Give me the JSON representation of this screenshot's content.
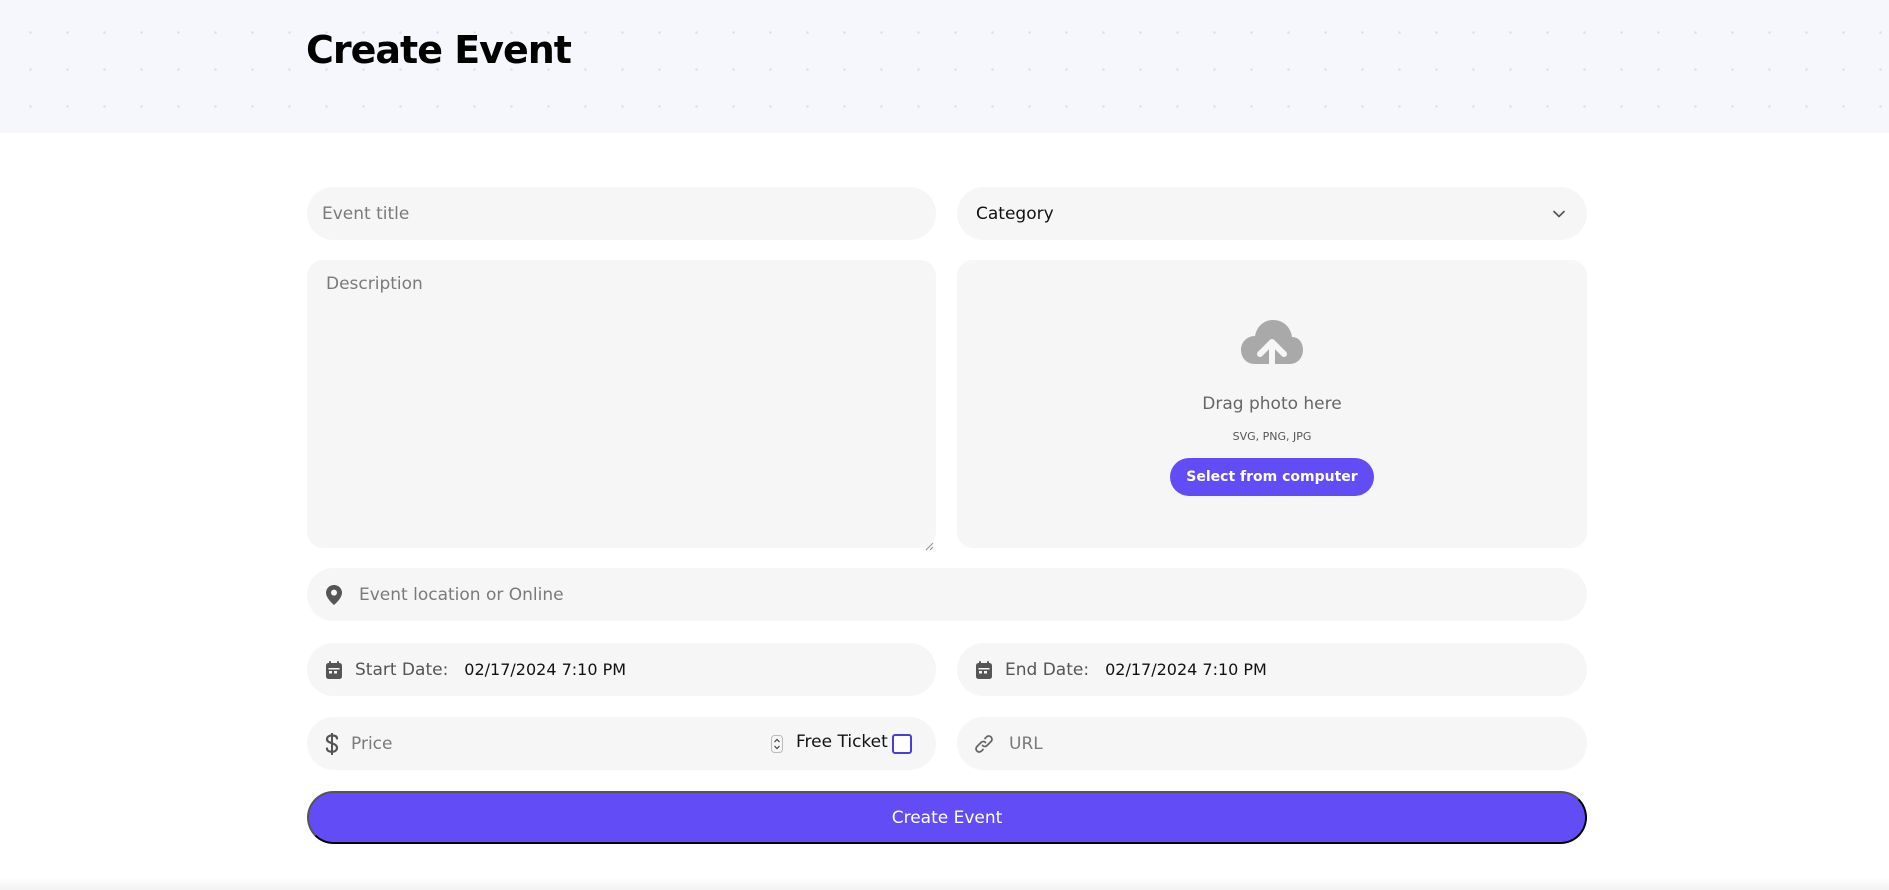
{
  "header": {
    "title": "Create Event"
  },
  "form": {
    "title_placeholder": "Event title",
    "category_label": "Category",
    "description_placeholder": "Description",
    "upload": {
      "drag_text": "Drag photo here",
      "formats": "SVG, PNG, JPG",
      "select_button": "Select from computer"
    },
    "location_placeholder": "Event location or Online",
    "start_date": {
      "label": "Start Date:",
      "value": "02/17/2024 7:10 PM"
    },
    "end_date": {
      "label": "End Date:",
      "value": "02/17/2024 7:10 PM"
    },
    "price_placeholder": "Price",
    "free_ticket_label": "Free Ticket",
    "free_ticket_checked": false,
    "url_placeholder": "URL",
    "submit_label": "Create Event"
  },
  "icons": {
    "category": "chevron-down-icon",
    "upload": "cloud-upload-icon",
    "location": "map-pin-icon",
    "date": "calendar-icon",
    "price": "dollar-icon",
    "url": "link-icon"
  },
  "colors": {
    "accent": "#624cf5",
    "field_bg": "#f6f6f6",
    "hero_bg": "#f5f7fc"
  }
}
